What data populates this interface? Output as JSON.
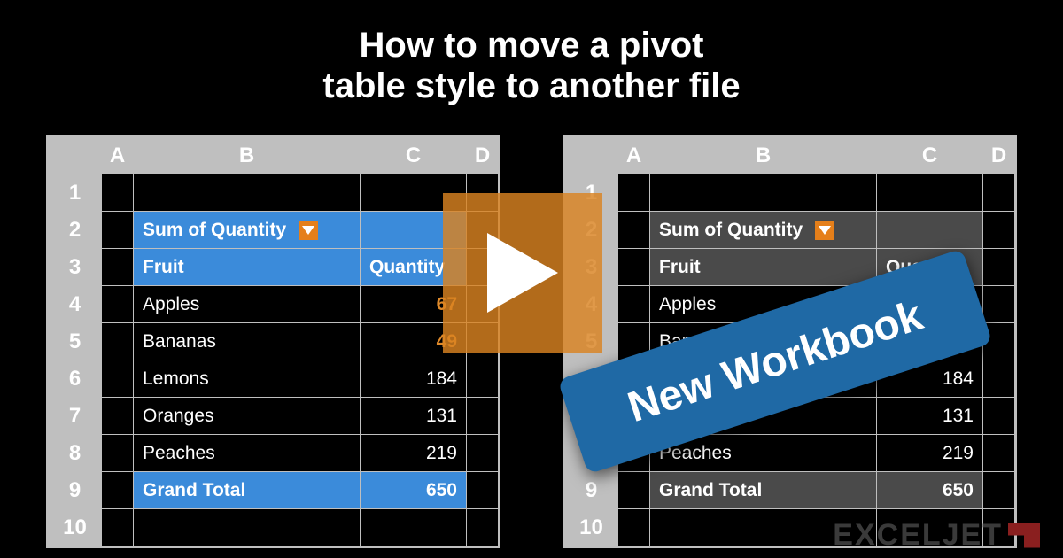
{
  "title_line1": "How to move a pivot",
  "title_line2": "table style to another file",
  "columns": {
    "a": "A",
    "b": "B",
    "c": "C",
    "d": "D"
  },
  "row_numbers": [
    "1",
    "2",
    "3",
    "4",
    "5",
    "6",
    "7",
    "8",
    "9",
    "10"
  ],
  "pivot": {
    "sum_label": "Sum of Quantity",
    "row_header": "Fruit",
    "col_header": "Quantity",
    "items": [
      {
        "name": "Apples",
        "qty": "67"
      },
      {
        "name": "Bananas",
        "qty": "49"
      },
      {
        "name": "Lemons",
        "qty": "184"
      },
      {
        "name": "Oranges",
        "qty": "131"
      },
      {
        "name": "Peaches",
        "qty": "219"
      }
    ],
    "total_label": "Grand Total",
    "total_value": "650"
  },
  "callout_label": "New Workbook",
  "brand_text": "EXCELJET"
}
